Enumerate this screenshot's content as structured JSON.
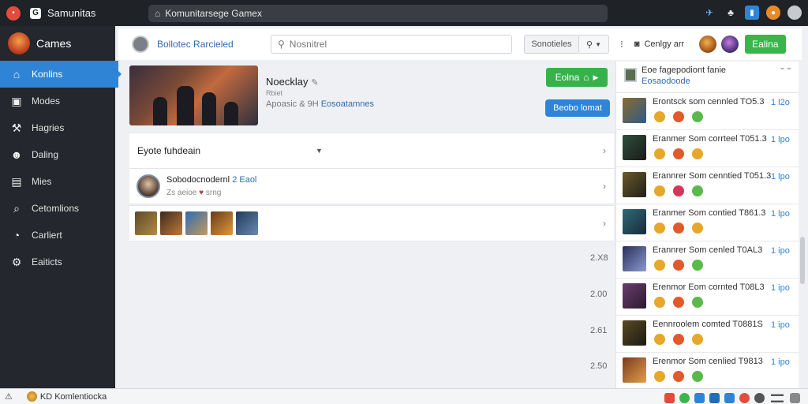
{
  "browser": {
    "title": "Samunitas",
    "url": "Komunitarsege Gamex",
    "url_icon": "⌂"
  },
  "sidebar": {
    "brand": "Cames",
    "items": [
      {
        "label": "Konlins",
        "icon": "home-icon",
        "glyph": "⌂",
        "active": true
      },
      {
        "label": "Modes",
        "icon": "monitor-icon",
        "glyph": "▣"
      },
      {
        "label": "Hagries",
        "icon": "wrench-icon",
        "glyph": "⚒"
      },
      {
        "label": "Daling",
        "icon": "users-icon",
        "glyph": "☻"
      },
      {
        "label": "Mies",
        "icon": "book-icon",
        "glyph": "▤"
      },
      {
        "label": "Cetomlions",
        "icon": "search-icon",
        "glyph": "⌕"
      },
      {
        "label": "Carliert",
        "icon": "clock-icon",
        "glyph": "◔"
      },
      {
        "label": "Eaiticts",
        "icon": "gear-icon",
        "glyph": "⚙"
      }
    ]
  },
  "header": {
    "name": "Bollotec Rarcieled",
    "search_placeholder": "Nosnitrel",
    "button": "Sonotieles",
    "status": "Cenlgy arr",
    "green_button": "Ealina"
  },
  "hero": {
    "title": "Noecklay",
    "subtitle": "Rbiet",
    "meta": "Apoasic & 9H",
    "meta_link": "Eosoatamnes",
    "green_button": "Eolna",
    "blue_button": "Beobo lomat"
  },
  "rows": {
    "dropdown": "Eyote fuhdeain",
    "user_name": "Sobodocnodernl",
    "user_badge": "2 Eaol",
    "user_sub": "Zs aeioe",
    "user_sub2": "srng"
  },
  "side_numbers": [
    "2.X8",
    "2.00",
    "2.61",
    "2.50"
  ],
  "right_panel": {
    "head_title": "Eoe fagepodiont fanie",
    "head_link": "Eosaodoode",
    "items": [
      {
        "title": "Erontsck som cennled TO5.3",
        "link": "1 l2o",
        "color": "#8a6b2f"
      },
      {
        "title": "Eranmer Som corrteel T051.3",
        "link": "1 lpo",
        "color": "#2f4f3a"
      },
      {
        "title": "Erannrer Som cenntied T051.3",
        "link": "1 lpo",
        "color": "#6b5a2a"
      },
      {
        "title": "Eranmer Som contied T861.3",
        "link": "1 lpo",
        "color": "#2d6b78"
      },
      {
        "title": "Erannrer Som cenled T0AL3",
        "link": "1 ipo",
        "color": "#2a2f58"
      },
      {
        "title": "Erenmor Eom cornted T08L3",
        "link": "1 ipo",
        "color": "#6a3d6e"
      },
      {
        "title": "Eennroolem comted T0881S",
        "link": "1 ipo",
        "color": "#5b4a24"
      },
      {
        "title": "Erenmor Som cenlied T9813",
        "link": "1 ipo",
        "color": "#7a3a1f"
      }
    ]
  },
  "taskbar": {
    "warning_glyph": "⚠",
    "label": "KD Komlentiocka"
  }
}
